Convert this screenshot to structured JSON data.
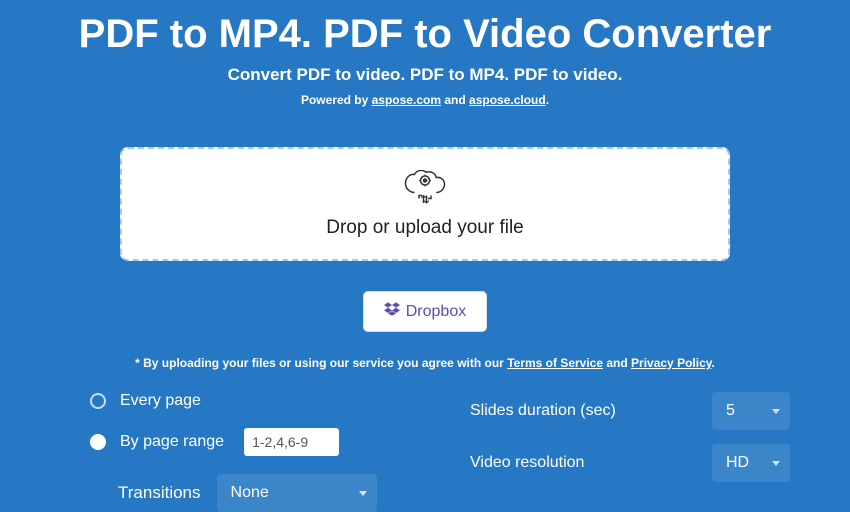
{
  "header": {
    "title": "PDF to MP4. PDF to Video Converter",
    "subtitle": "Convert PDF to video. PDF to MP4. PDF to video.",
    "powered_prefix": "Powered by ",
    "powered_link1": "aspose.com",
    "powered_and": " and ",
    "powered_link2": "aspose.cloud",
    "powered_suffix": "."
  },
  "dropzone": {
    "text": "Drop or upload your file"
  },
  "dropbox_button": {
    "label": "Dropbox"
  },
  "disclaimer": {
    "prefix": "* By uploading your files or using our service you agree with our ",
    "tos": "Terms of Service",
    "and": " and ",
    "privacy": "Privacy Policy",
    "suffix": "."
  },
  "options": {
    "every_page": "Every page",
    "by_page_range": "By page range",
    "page_range_value": "1-2,4,6-9",
    "slides_duration_label": "Slides duration (sec)",
    "slides_duration_value": "5",
    "video_resolution_label": "Video resolution",
    "video_resolution_value": "HD",
    "transitions_label": "Transitions",
    "transitions_value": "None"
  }
}
